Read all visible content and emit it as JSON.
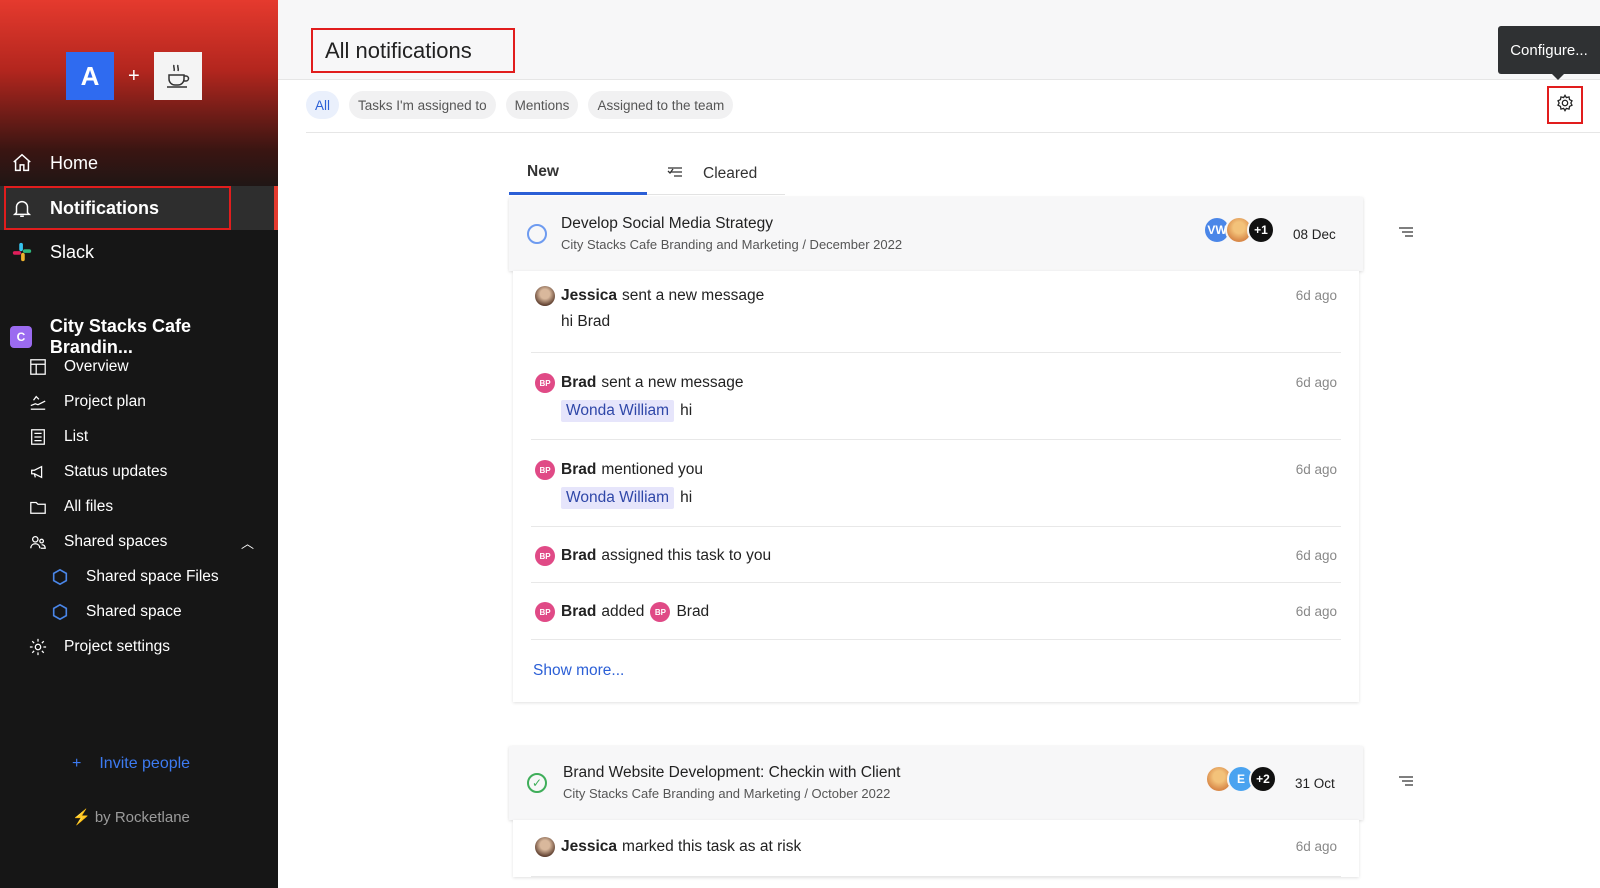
{
  "sidebar": {
    "logo_letter": "A",
    "logo_plus": "+",
    "nav": [
      {
        "label": "Home",
        "icon": "home-icon"
      },
      {
        "label": "Notifications",
        "icon": "bell-icon"
      },
      {
        "label": "Slack",
        "icon": "slack-icon"
      }
    ],
    "project": {
      "badge": "C",
      "name": "City Stacks Cafe Brandin..."
    },
    "items": [
      {
        "label": "Overview",
        "icon": "overview-icon"
      },
      {
        "label": "Project plan",
        "icon": "project-plan-icon"
      },
      {
        "label": "List",
        "icon": "list-icon"
      },
      {
        "label": "Status updates",
        "icon": "megaphone-icon"
      },
      {
        "label": "All files",
        "icon": "folder-icon"
      },
      {
        "label": "Shared spaces",
        "icon": "people-icon"
      },
      {
        "label": "Shared space Files",
        "icon": "hexagon-icon"
      },
      {
        "label": "Shared space",
        "icon": "hexagon-icon"
      },
      {
        "label": "Project settings",
        "icon": "gear-icon"
      }
    ],
    "invite_plus": "+",
    "invite_label": "Invite people",
    "byline": "⚡ by Rocketlane"
  },
  "header": {
    "title": "All notifications",
    "configure_tooltip": "Configure..."
  },
  "filters": [
    "All",
    "Tasks I'm assigned to",
    "Mentions",
    "Assigned to the team"
  ],
  "tabs": {
    "new": "New",
    "cleared": "Cleared"
  },
  "cards": [
    {
      "title": "Develop Social Media Strategy",
      "subtitle": "City Stacks Cafe Branding and Marketing / December 2022",
      "avatars": [
        "VW",
        "",
        "+1"
      ],
      "date": "08 Dec",
      "notifications": [
        {
          "actor": "Jessica",
          "text": "sent a new message",
          "time": "6d ago",
          "message": "hi Brad"
        },
        {
          "actor": "Brad",
          "actor_initials": "BP",
          "text": "sent a new message",
          "time": "6d ago",
          "mention": "Wonda William",
          "message": "hi"
        },
        {
          "actor": "Brad",
          "actor_initials": "BP",
          "text": "mentioned you",
          "time": "6d ago",
          "mention": "Wonda William",
          "message": "hi"
        },
        {
          "actor": "Brad",
          "actor_initials": "BP",
          "text": "assigned this task to you",
          "time": "6d ago"
        },
        {
          "actor": "Brad",
          "actor_initials": "BP",
          "text": "added",
          "target_initials": "BP",
          "target": "Brad",
          "time": "6d ago"
        }
      ],
      "show_more": "Show more..."
    },
    {
      "title": "Brand Website Development: Checkin with Client",
      "subtitle": "City Stacks Cafe Branding and Marketing / October 2022",
      "avatars": [
        "",
        "E",
        "+2"
      ],
      "date": "31 Oct",
      "notifications": [
        {
          "actor": "Jessica",
          "text": "marked this task as at risk",
          "time": "6d ago"
        }
      ]
    }
  ],
  "colors": {
    "accent": "#2b5fd6",
    "brand_red": "#e53a2e",
    "highlight_box": "#e11d1d"
  }
}
